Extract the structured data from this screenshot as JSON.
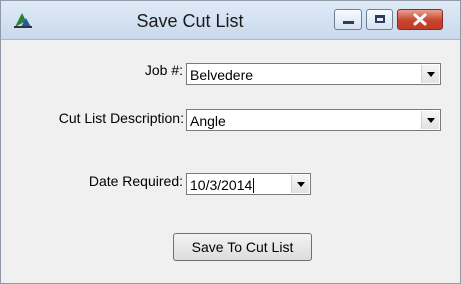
{
  "window": {
    "title": "Save Cut List"
  },
  "form": {
    "job": {
      "label": "Job #:",
      "value": "Belvedere"
    },
    "description": {
      "label": "Cut List Description:",
      "value": "Angle"
    },
    "date_required": {
      "label": "Date Required:",
      "value": "10/3/2014"
    }
  },
  "actions": {
    "save_label": "Save To Cut List"
  },
  "colors": {
    "titlebar": "#c9d9ec",
    "close_button": "#c8452f",
    "window_bg": "#f0f0f0"
  },
  "icons": [
    "app-icon",
    "minimize-icon",
    "maximize-icon",
    "close-icon",
    "chevron-down-icon"
  ]
}
